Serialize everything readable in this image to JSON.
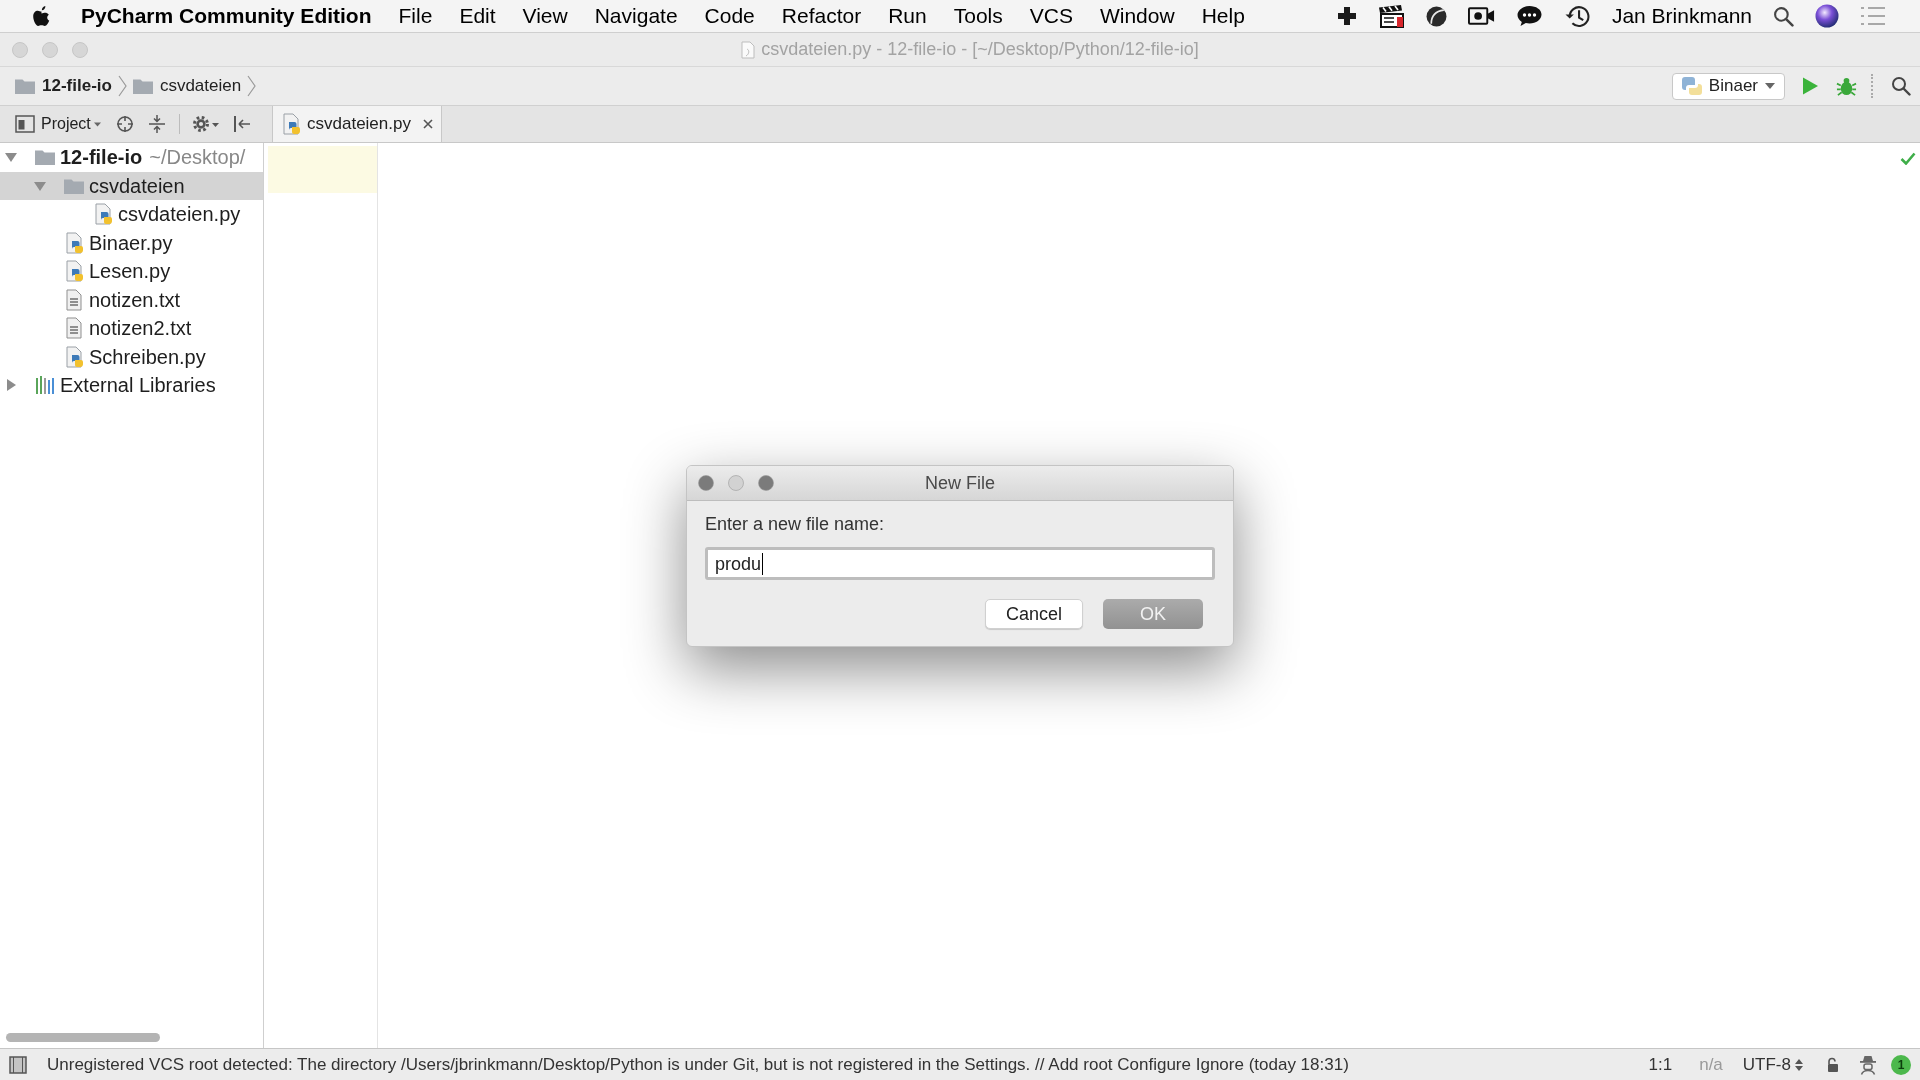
{
  "menu_bar": {
    "app_name": "PyCharm Community Edition",
    "menus": [
      "File",
      "Edit",
      "View",
      "Navigate",
      "Code",
      "Refactor",
      "Run",
      "Tools",
      "VCS",
      "Window",
      "Help"
    ],
    "user": "Jan Brinkmann"
  },
  "window": {
    "title": "csvdateien.py - 12-file-io - [~/Desktop/Python/12-file-io]"
  },
  "breadcrumbs": [
    {
      "label": "12-file-io",
      "kind": "project"
    },
    {
      "label": "csvdateien",
      "kind": "folder"
    }
  ],
  "run_config": {
    "label": "Binaer"
  },
  "project_panel": {
    "title": "Project",
    "tree": [
      {
        "label": "12-file-io",
        "suffix": "~/Desktop/",
        "kind": "project",
        "expanded": true,
        "selected": false,
        "children": [
          {
            "label": "csvdateien",
            "kind": "folder",
            "expanded": true,
            "selected": true,
            "children": [
              {
                "label": "csvdateien.py",
                "kind": "python",
                "selected": false
              }
            ]
          },
          {
            "label": "Binaer.py",
            "kind": "python",
            "selected": false
          },
          {
            "label": "Lesen.py",
            "kind": "python",
            "selected": false
          },
          {
            "label": "notizen.txt",
            "kind": "text",
            "selected": false
          },
          {
            "label": "notizen2.txt",
            "kind": "text",
            "selected": false
          },
          {
            "label": "Schreiben.py",
            "kind": "python",
            "selected": false
          }
        ]
      },
      {
        "label": "External Libraries",
        "kind": "library",
        "expanded": false,
        "selected": false
      }
    ]
  },
  "editor": {
    "tabs": [
      {
        "label": "csvdateien.py",
        "selected": true
      }
    ]
  },
  "dialog": {
    "title": "New File",
    "prompt": "Enter a new file name:",
    "field": {
      "value": "produ"
    },
    "buttons": [
      {
        "label": "Cancel",
        "kind": "secondary"
      },
      {
        "label": "OK",
        "kind": "default"
      }
    ]
  },
  "status_bar": {
    "message": "Unregistered VCS root detected: The directory /Users/jbrinkmann/Desktop/Python is under Git, but is not registered in the Settings. // Add root Configure Ignore (today 18:31)",
    "position": "1:1",
    "line_separator": "n/a",
    "encoding": "UTF-8",
    "notifications": "1"
  }
}
